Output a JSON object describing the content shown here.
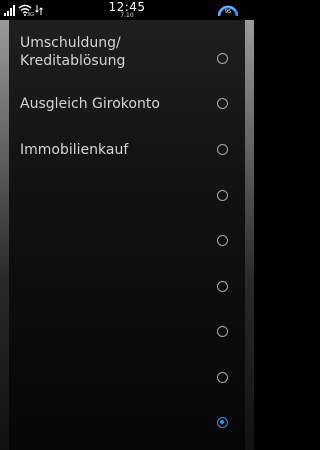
{
  "status_bar": {
    "time": "12:45",
    "date": "7.10",
    "signal_icon": "signal-bars-icon",
    "wifi_icon": "wifi-icon",
    "data_label": "3G",
    "battery_level": "95"
  },
  "options": [
    {
      "label": "Umschuldung/\nKreditablösung",
      "selected": false
    },
    {
      "label": "Ausgleich Girokonto",
      "selected": false
    },
    {
      "label": "Immobilienkauf",
      "selected": false
    },
    {
      "label": "",
      "selected": false
    },
    {
      "label": "",
      "selected": false
    },
    {
      "label": "",
      "selected": false
    },
    {
      "label": "",
      "selected": false
    },
    {
      "label": "",
      "selected": false
    },
    {
      "label": "",
      "selected": true
    }
  ],
  "colors": {
    "accent": "#3a8ee6",
    "radio_border": "#a8a8a8",
    "text": "#d4d4d4"
  }
}
